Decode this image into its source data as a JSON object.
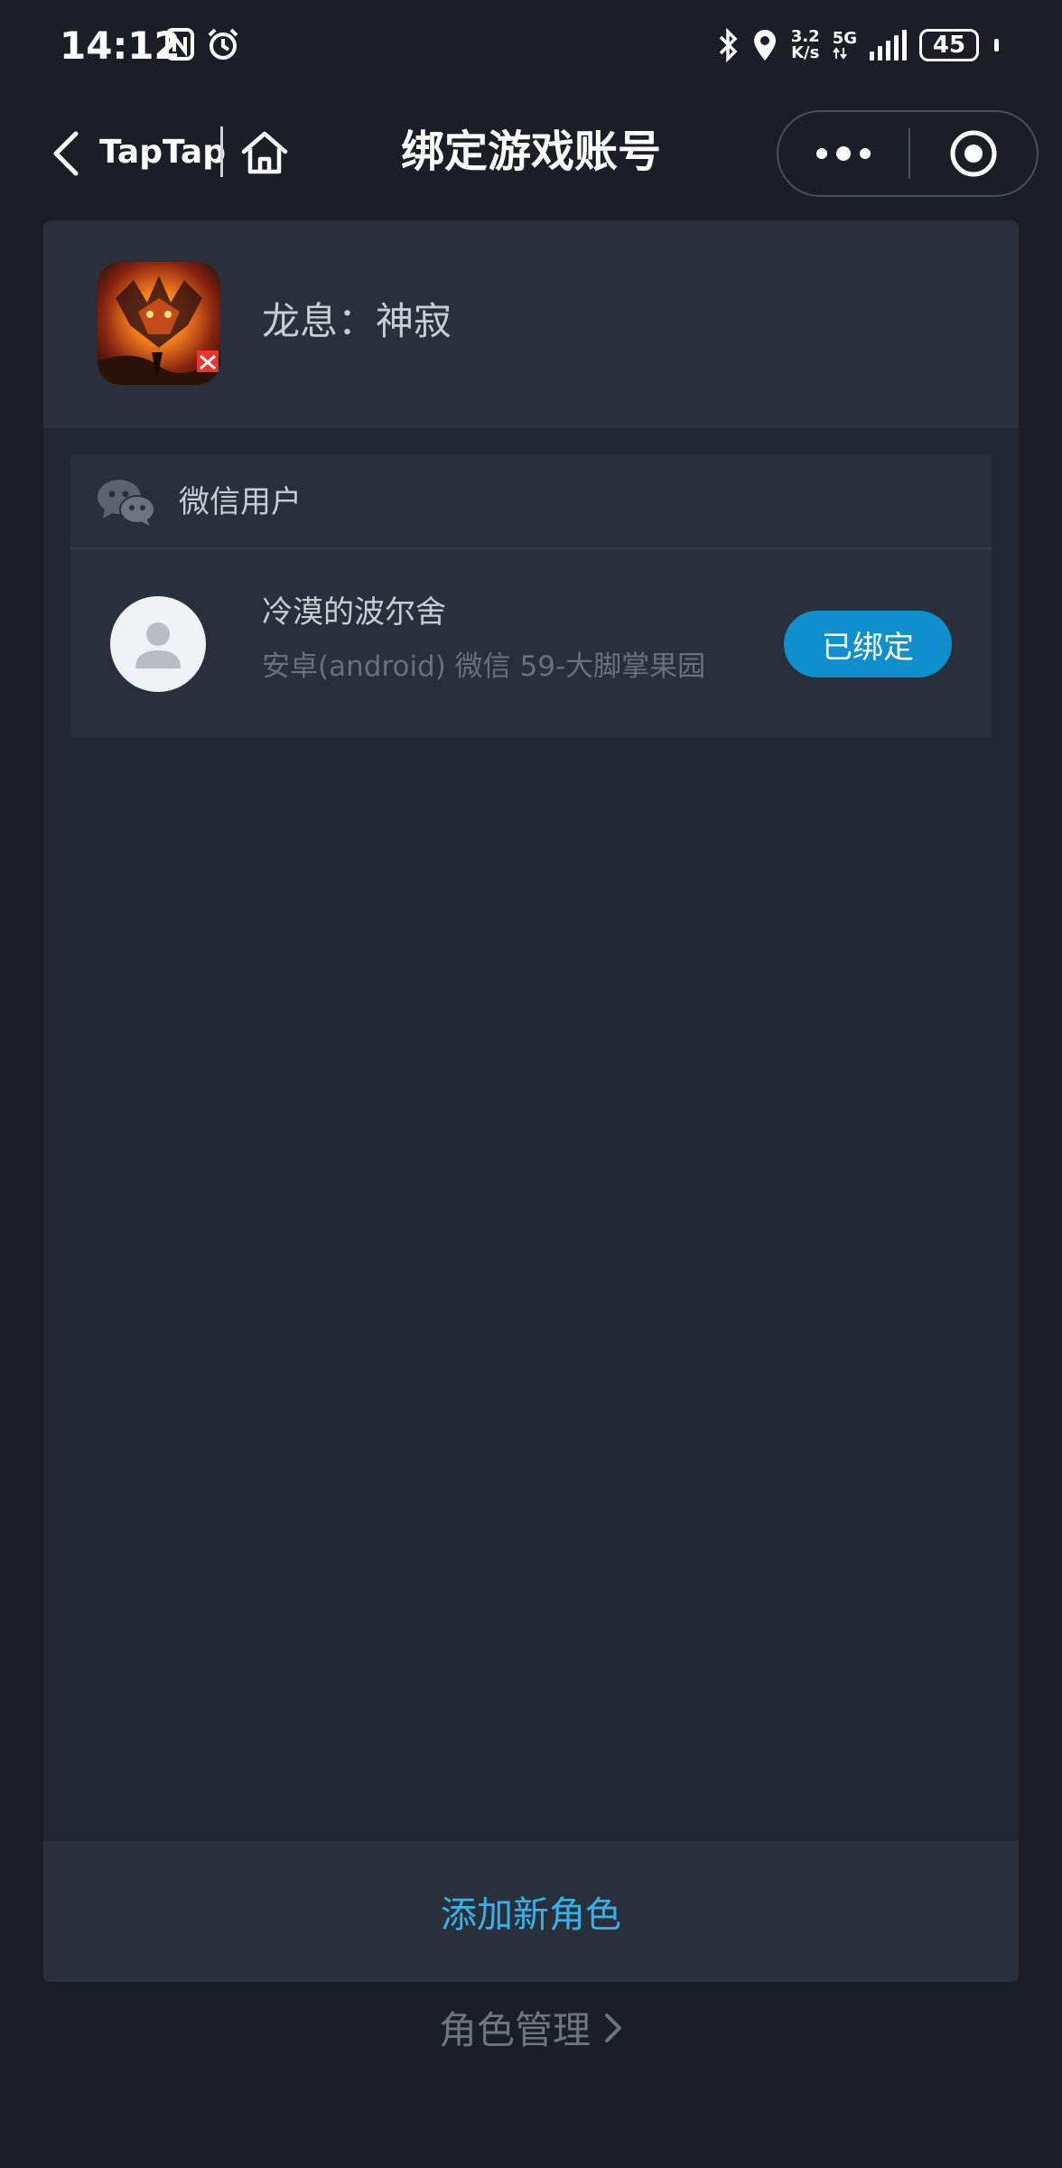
{
  "status_bar": {
    "time": "14:12",
    "net_speed_value": "3.2",
    "net_speed_unit": "K/s",
    "network": "5G",
    "battery": "45"
  },
  "nav": {
    "source_app": "TapTap",
    "title": "绑定游戏账号"
  },
  "game": {
    "name": "龙息：神寂"
  },
  "account": {
    "platform": "微信用户",
    "role_name": "冷漠的波尔舍",
    "role_detail": "安卓(android) 微信 59-大脚掌果园",
    "bound_label": "已绑定"
  },
  "actions": {
    "add_role": "添加新角色",
    "manage_roles": "角色管理"
  },
  "colors": {
    "accent": "#0f8fce",
    "link": "#36b3e6",
    "background": "#1b1e26"
  }
}
